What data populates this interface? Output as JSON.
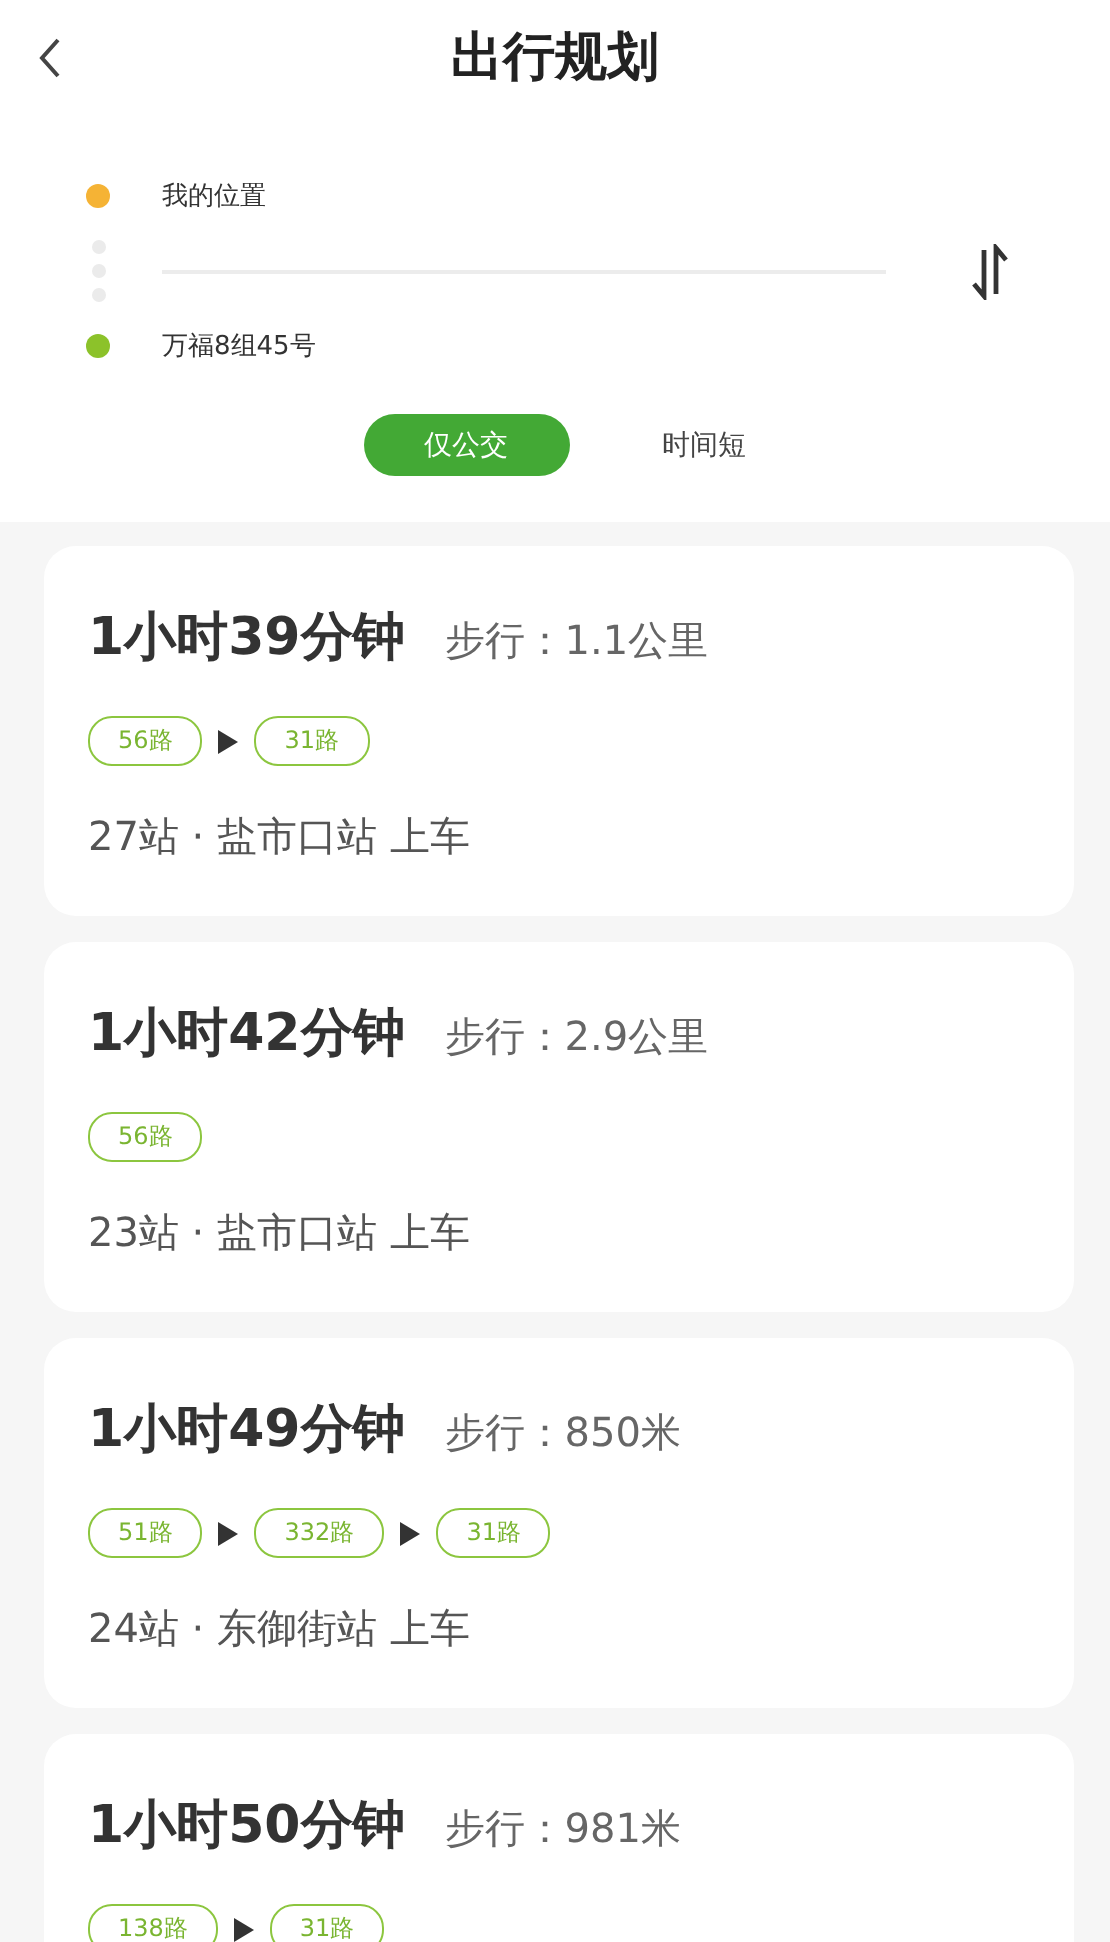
{
  "header": {
    "title": "出行规划"
  },
  "points": [
    {
      "label": "我的位置",
      "color": "#f5b335"
    },
    {
      "label": "万福8组45号",
      "color": "#8cc22a"
    }
  ],
  "tabs": [
    {
      "label": "仅公交",
      "selected": true
    },
    {
      "label": "时间短",
      "selected": false
    }
  ],
  "routes": [
    {
      "duration": "1小时39分钟",
      "walk": "步行：1.1公里",
      "lines": [
        "56路",
        "31路"
      ],
      "stops": "27站 · 盐市口站 上车"
    },
    {
      "duration": "1小时42分钟",
      "walk": "步行：2.9公里",
      "lines": [
        "56路"
      ],
      "stops": "23站 · 盐市口站 上车"
    },
    {
      "duration": "1小时49分钟",
      "walk": "步行：850米",
      "lines": [
        "51路",
        "332路",
        "31路"
      ],
      "stops": "24站 · 东御街站 上车"
    },
    {
      "duration": "1小时50分钟",
      "walk": "步行：981米",
      "lines": [
        "138路",
        "31路"
      ]
    }
  ]
}
